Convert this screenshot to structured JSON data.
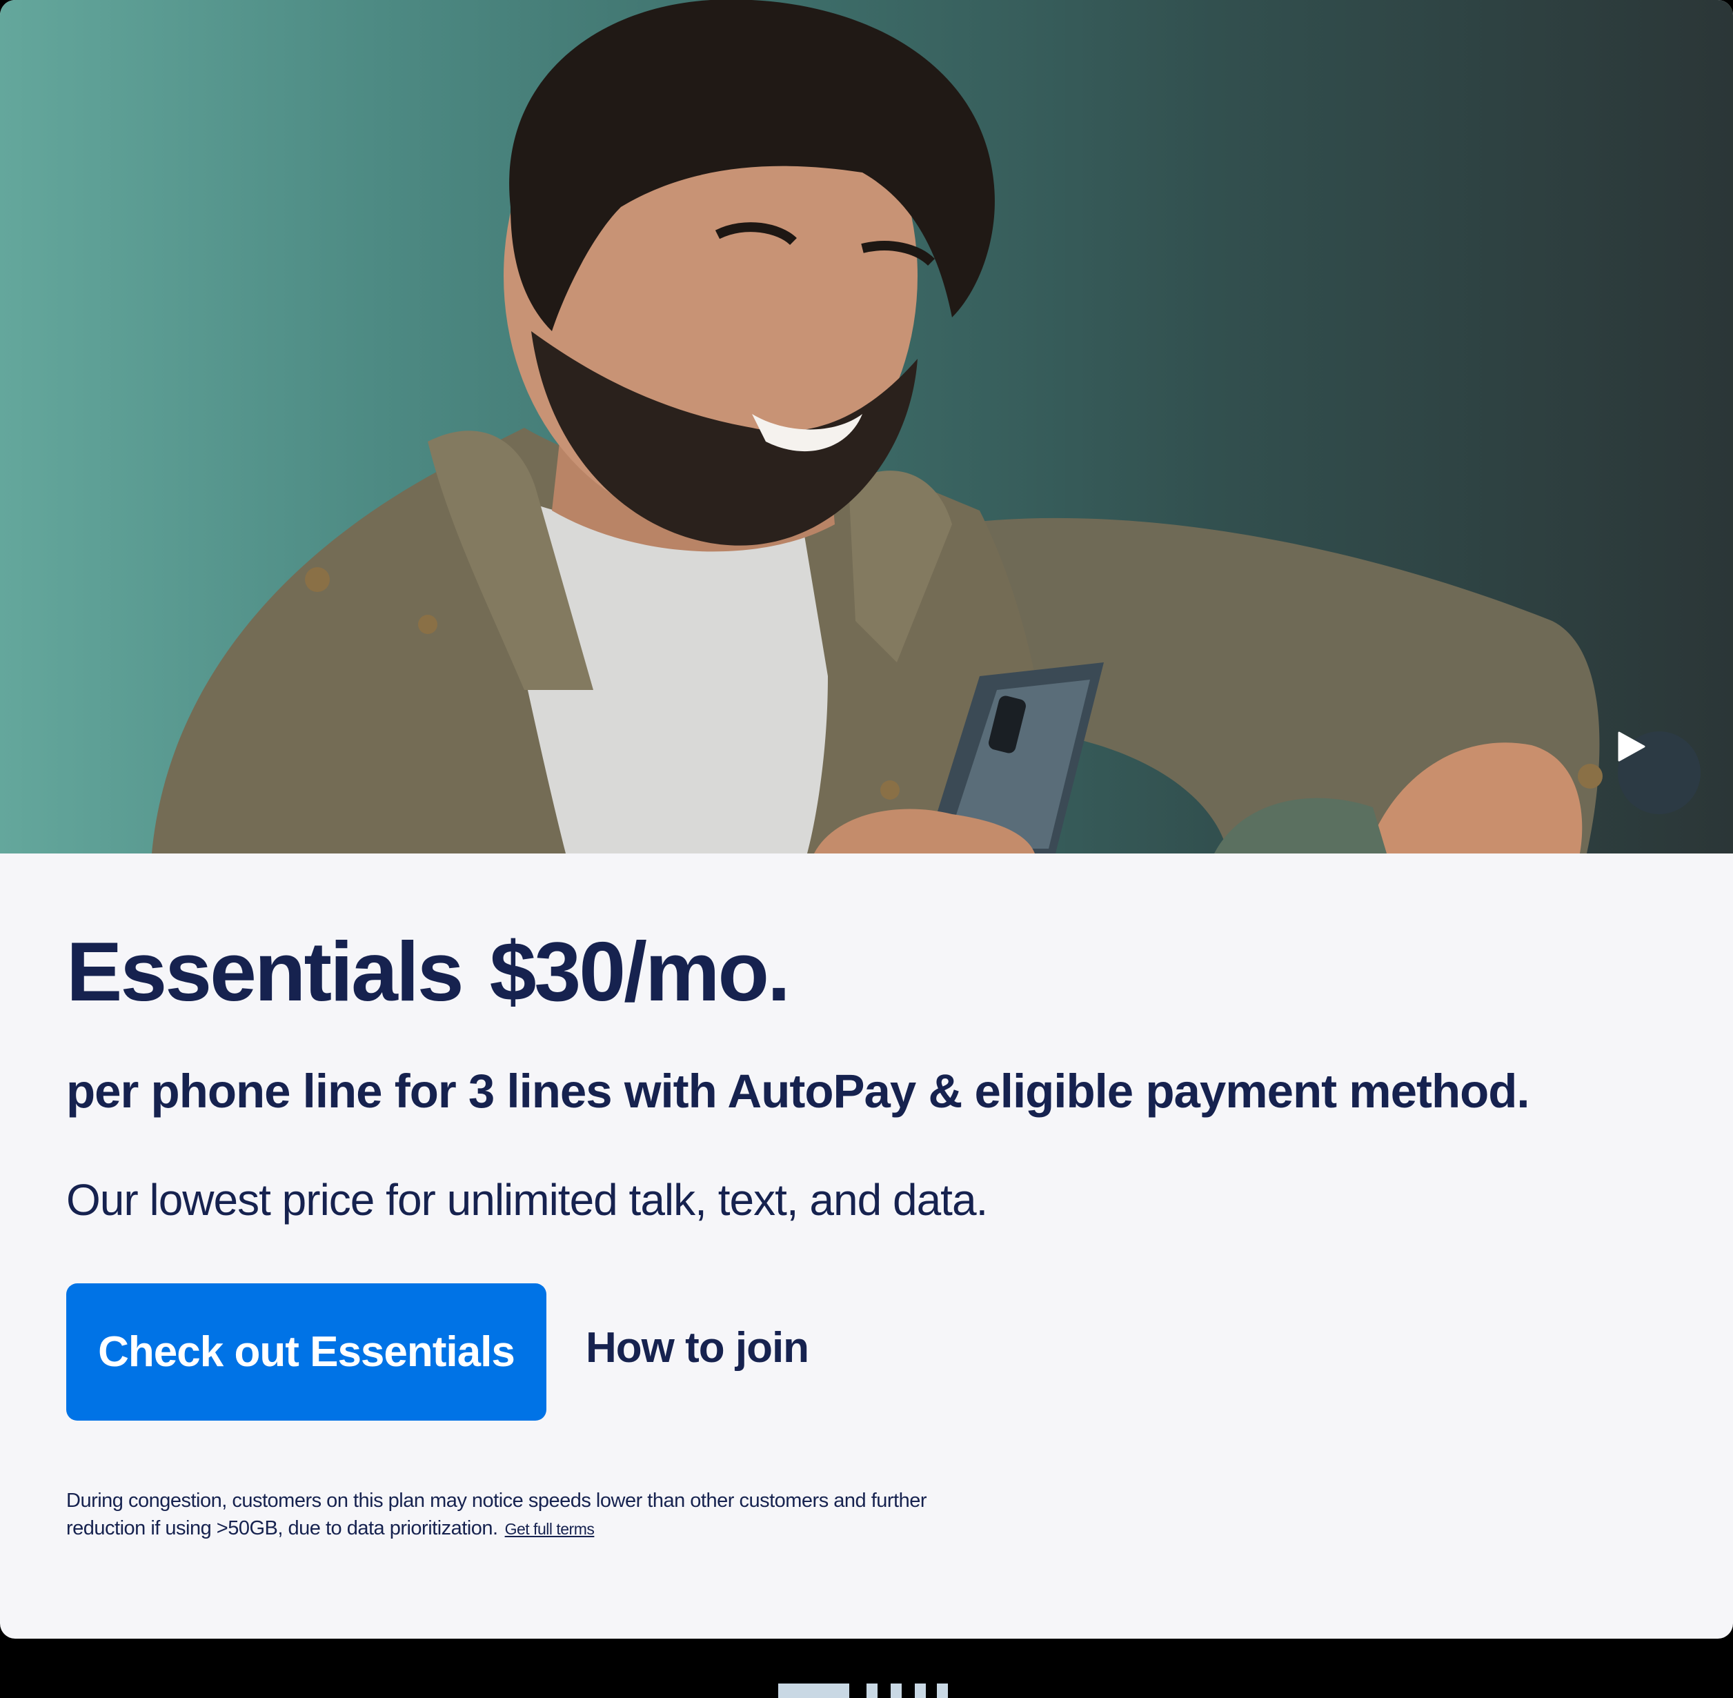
{
  "hero": {
    "image_alt": "Smiling man with curly hair looking at his phone",
    "play_icon": "play-icon"
  },
  "plan": {
    "name": "Essentials",
    "price": "$30/mo.",
    "subtitle": "per phone line for 3 lines with AutoPay & eligible payment method.",
    "tagline": "Our lowest price for unlimited talk, text, and data."
  },
  "actions": {
    "primary_label": "Check out Essentials",
    "secondary_label": "How to join"
  },
  "disclaimer": {
    "text": "During congestion, customers on this plan may notice speeds lower than other customers and further reduction if using >50GB, due to data prioritization.",
    "link_label": "Get full terms"
  },
  "colors": {
    "navy": "#16224f",
    "primary_blue": "#0073e6",
    "card_bg": "#f6f6f9"
  }
}
